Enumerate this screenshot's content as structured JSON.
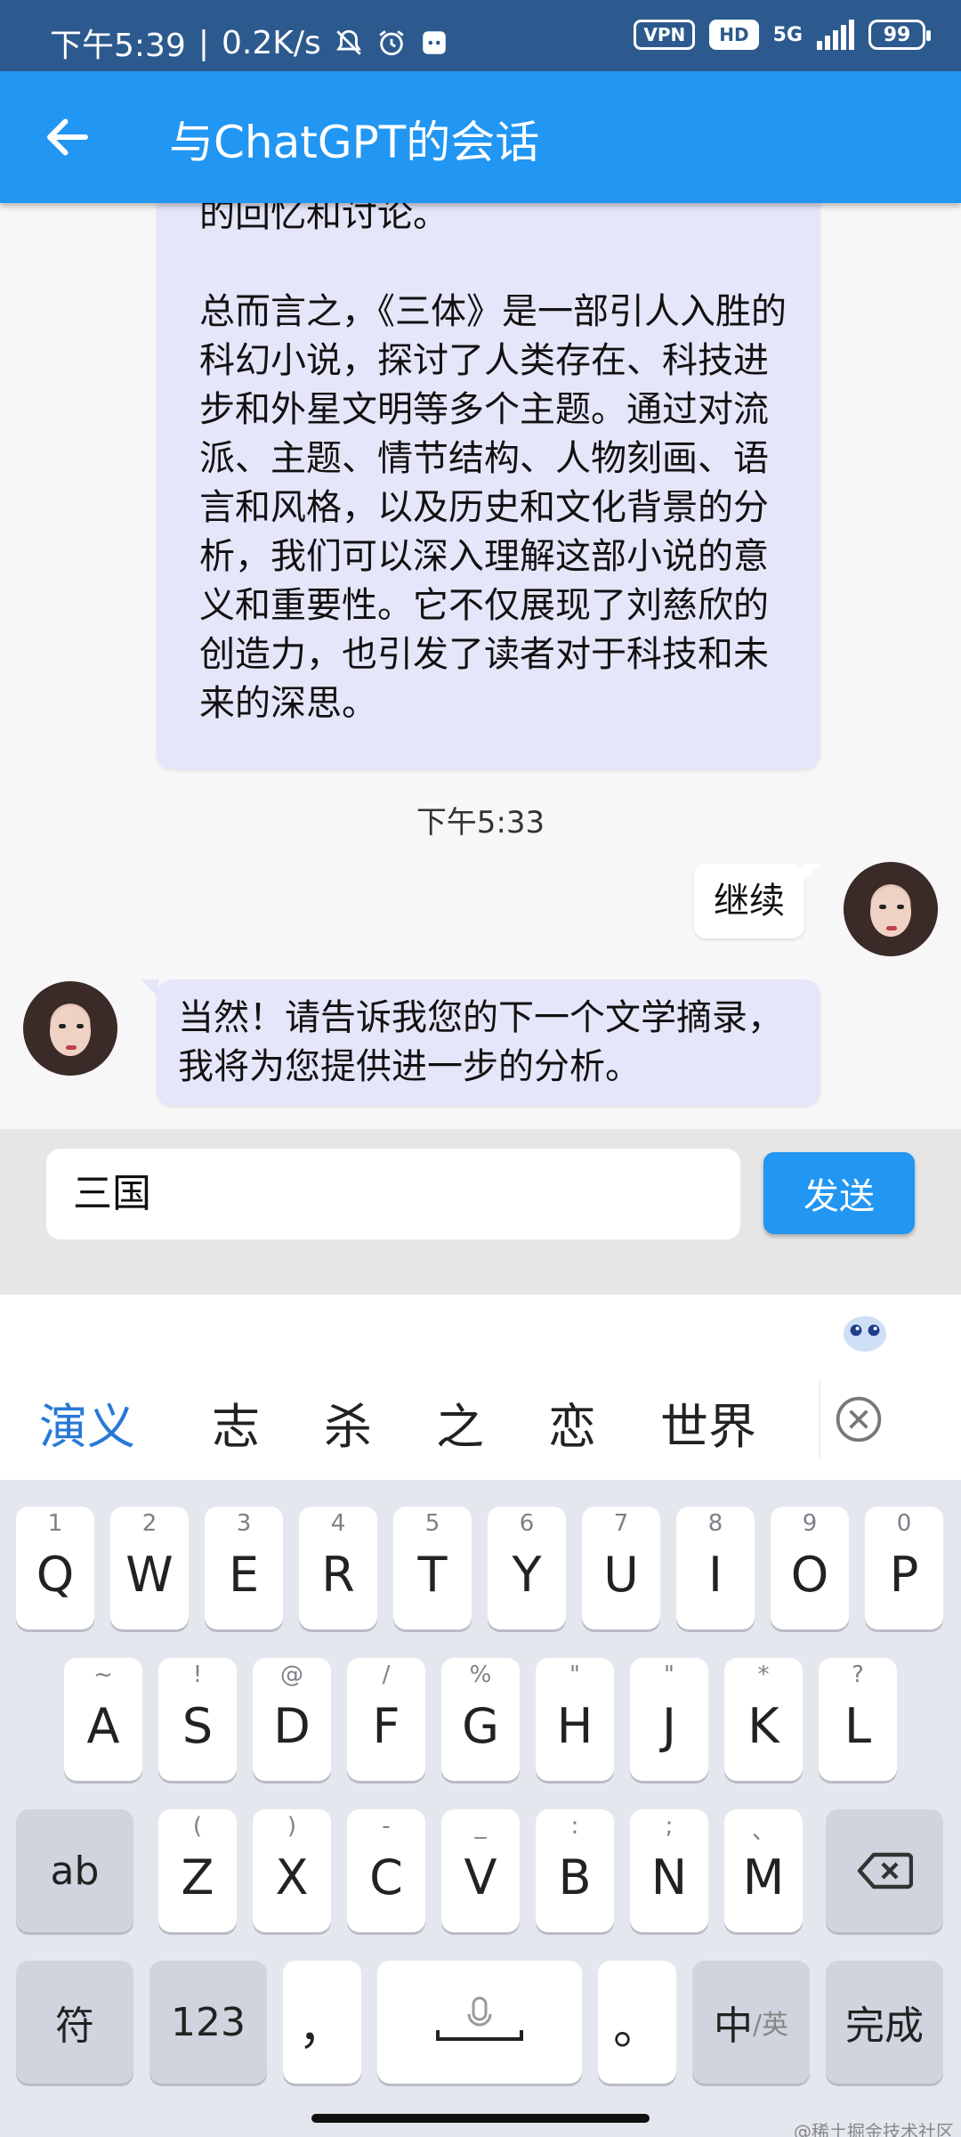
{
  "status_bar": {
    "time": "下午5:39",
    "speed": "0.2K/s",
    "vpn": "VPN",
    "hd": "HD",
    "network": "5G",
    "battery": "99",
    "icons": [
      "mute-bell-icon",
      "alarm-icon",
      "app-notification-icon",
      "signal-icon"
    ]
  },
  "app_bar": {
    "title": "与ChatGPT的会话",
    "back_icon": "arrow-left-icon"
  },
  "chat": {
    "messages": [
      {
        "sender": "assistant",
        "paragraphs": [
          "的回忆和讨论。",
          "总而言之，《三体》是一部引人入胜的科幻小说，探讨了人类存在、科技进步和外星文明等多个主题。通过对流派、主题、情节结构、人物刻画、语言和风格，以及历史和文化背景的分析，我们可以深入理解这部小说的意义和重要性。它不仅展现了刘慈欣的创造力，也引发了读者对于科技和未来的深思。"
        ]
      },
      {
        "sender": "system",
        "timestamp": "下午5:33"
      },
      {
        "sender": "user",
        "text": "继续"
      },
      {
        "sender": "assistant",
        "text": "当然！请告诉我您的下一个文学摘录，我将为您提供进一步的分析。"
      }
    ]
  },
  "composer": {
    "input_value": "三国",
    "send_label": "发送"
  },
  "keyboard": {
    "candidates": [
      "演义",
      "志",
      "杀",
      "之",
      "恋",
      "世界"
    ],
    "row1": [
      {
        "k": "Q",
        "h": "1"
      },
      {
        "k": "W",
        "h": "2"
      },
      {
        "k": "E",
        "h": "3"
      },
      {
        "k": "R",
        "h": "4"
      },
      {
        "k": "T",
        "h": "5"
      },
      {
        "k": "Y",
        "h": "6"
      },
      {
        "k": "U",
        "h": "7"
      },
      {
        "k": "I",
        "h": "8"
      },
      {
        "k": "O",
        "h": "9"
      },
      {
        "k": "P",
        "h": "0"
      }
    ],
    "row2": [
      {
        "k": "A",
        "h": "~"
      },
      {
        "k": "S",
        "h": "!"
      },
      {
        "k": "D",
        "h": "@"
      },
      {
        "k": "F",
        "h": "/"
      },
      {
        "k": "G",
        "h": "%"
      },
      {
        "k": "H",
        "h": "\""
      },
      {
        "k": "J",
        "h": "\""
      },
      {
        "k": "K",
        "h": "*"
      },
      {
        "k": "L",
        "h": "?"
      }
    ],
    "row3": [
      {
        "k": "Z",
        "h": "("
      },
      {
        "k": "X",
        "h": ")"
      },
      {
        "k": "C",
        "h": "-"
      },
      {
        "k": "V",
        "h": "_"
      },
      {
        "k": "B",
        "h": ":"
      },
      {
        "k": "N",
        "h": ";"
      },
      {
        "k": "M",
        "h": "、"
      }
    ],
    "ab": "ab",
    "symbols": "符",
    "numbers": "123",
    "comma": "，",
    "period": "。",
    "lang_main": "中",
    "lang_alt": "/英",
    "done": "完成"
  },
  "watermark": "@稀土掘金技术社区"
}
